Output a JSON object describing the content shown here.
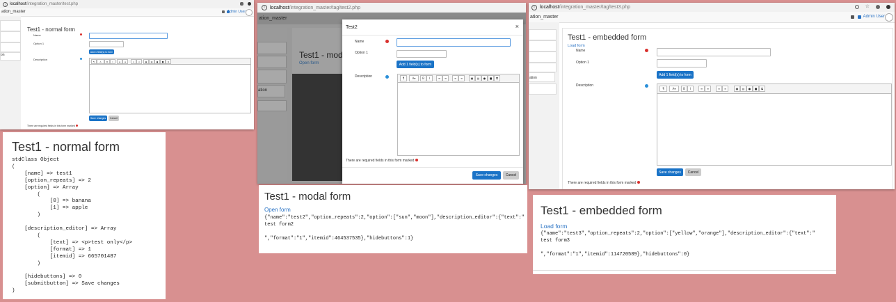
{
  "colors": {
    "background": "#d89090",
    "primary": "#1a73c7",
    "required": "#d9302d",
    "help": "#2a8fd9",
    "link": "#2a73c4"
  },
  "win1": {
    "url_host": "localhost",
    "url_path": "/integration_master/test.php",
    "navbar_brand": "ation_master",
    "user": "Admin User",
    "sidebar_items": [
      "",
      "",
      "",
      ""
    ],
    "sidebar_label": "on",
    "title": "Test1 - normal form",
    "name_label": "Name",
    "option_label": "Option 1",
    "add_button": "Add 1 field(s) to form",
    "description_label": "Description",
    "save_button": "Save changes",
    "cancel_button": "Cancel",
    "required_note": "There are required fields in this form marked"
  },
  "win2": {
    "url_host": "localhost",
    "url_path": "/integration_master/tag/test2.php",
    "navbar_brand": "ation_master",
    "sidebar_label": "ation",
    "bg_title": "Test1 - modal",
    "bg_link": "Open form",
    "modal_title": "Test2",
    "close_label": "×",
    "name_label": "Name",
    "option_label": "Option 1",
    "add_button": "Add 1 field(s) to form",
    "description_label": "Description",
    "required_note": "There are required fields in this form marked",
    "save_button": "Save changes",
    "cancel_button": "Cancel"
  },
  "win3": {
    "url_host": "localhost",
    "url_path": "/integration_master/tag/test3.php",
    "navbar_brand": "ation_master",
    "user": "Admin User",
    "sidebar_label": "ation",
    "title": "Test1 - embedded form",
    "load_link": "Load form",
    "name_label": "Name",
    "option_label": "Option 1",
    "add_button": "Add 1 field(s) to form",
    "description_label": "Description",
    "save_button": "Save changes",
    "cancel_button": "Cancel",
    "required_note": "There are required fields in this form marked"
  },
  "panel1": {
    "title": "Test1 - normal form",
    "output": "stdClass Object\n(\n    [name] => test1\n    [option_repeats] => 2\n    [option] => Array\n        (\n            [0] => banana\n            [1] => apple\n        )\n\n    [description_editor] => Array\n        (\n            [text] => <p>test only</p>\n            [format] => 1\n            [itemid] => 665701487\n        )\n\n    [hidebuttons] => 0\n    [submitbutton] => Save changes\n)"
  },
  "panel2": {
    "title": "Test1 - modal form",
    "link": "Open form",
    "output": "{\"name\":\"test2\",\"option_repeats\":2,\"option\":[\"sun\",\"moon\"],\"description_editor\":{\"text\":\"\ntest form2\n\n\",\"format\":\"1\",\"itemid\":464537535},\"hidebuttons\":1}"
  },
  "panel3": {
    "title": "Test1 - embedded form",
    "link": "Load form",
    "output": "{\"name\":\"test3\",\"option_repeats\":2,\"option\":[\"yellow\",\"orange\"],\"description_editor\":{\"text\":\"\ntest form3\n\n\",\"format\":\"1\",\"itemid\":114720589},\"hidebuttons\":0}"
  }
}
